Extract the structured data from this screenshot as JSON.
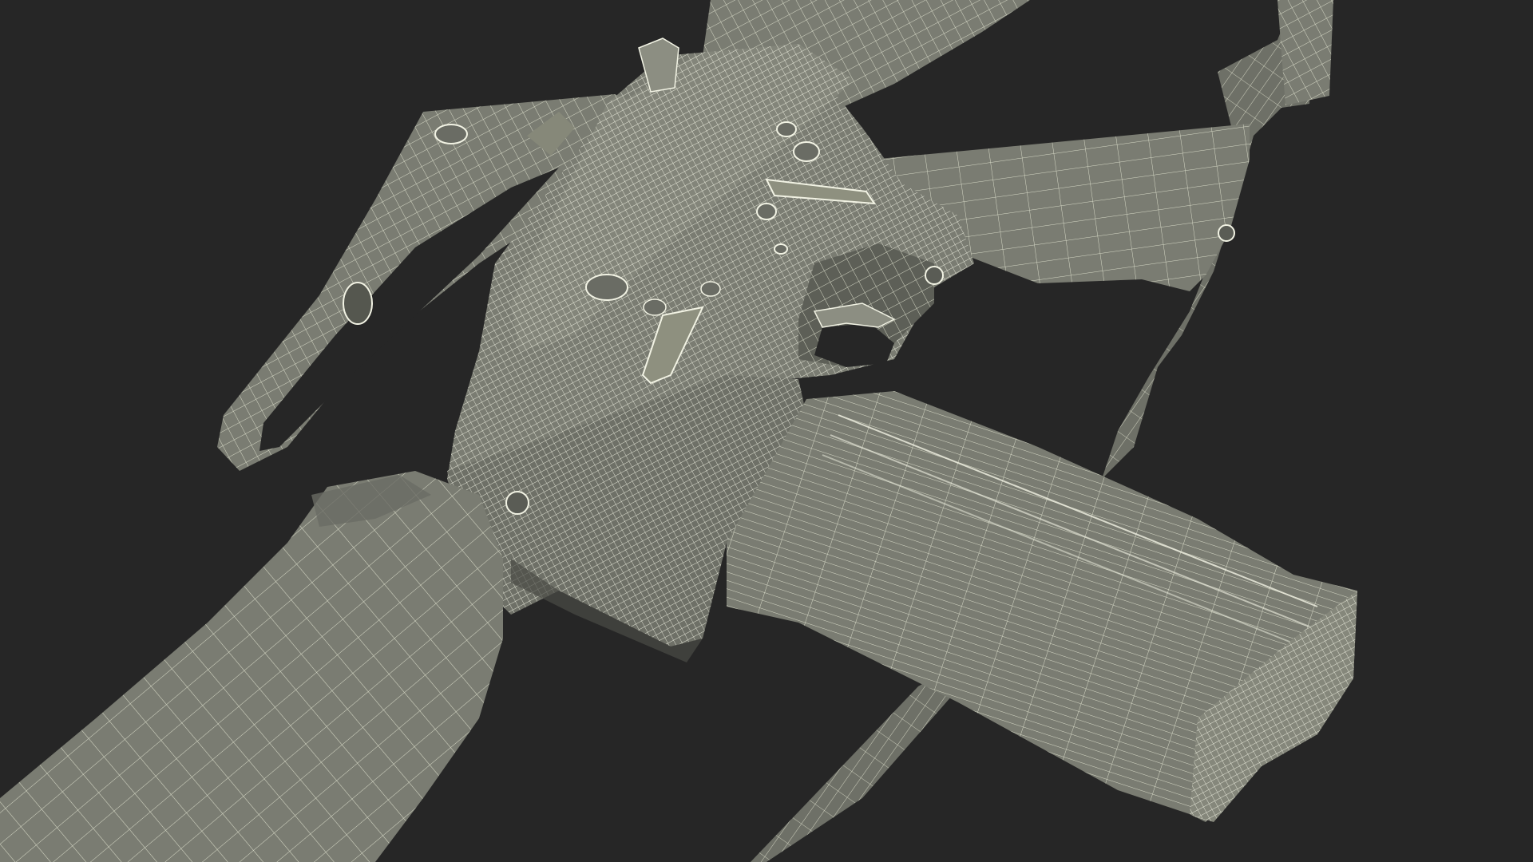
{
  "scene": {
    "subject": "rifle-wireframe-render",
    "background_color": "#262626",
    "surface_color": "#787a70",
    "surface_shade_color": "#60625a",
    "surface_dark_color": "#4a4c46",
    "wire_color": "#e8ead6",
    "wire_dense_color": "#f2f3e4"
  }
}
